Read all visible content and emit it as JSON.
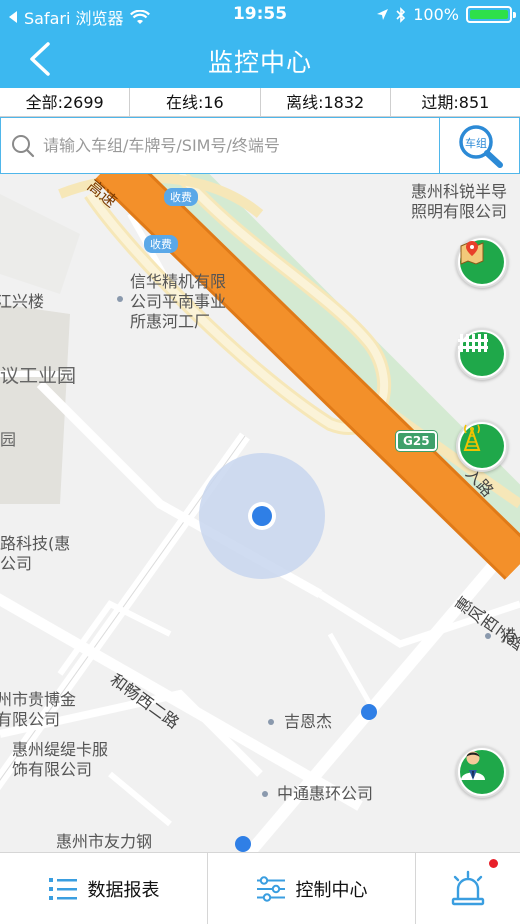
{
  "status_bar": {
    "carrier": "Safari 浏览器",
    "time": "19:55",
    "battery": "100%"
  },
  "nav": {
    "title": "监控中心"
  },
  "stats": [
    {
      "label": "全部:2699"
    },
    {
      "label": "在线:16"
    },
    {
      "label": "离线:1832"
    },
    {
      "label": "过期:851"
    }
  ],
  "search": {
    "placeholder": "请输入车组/车牌号/SIM号/终端号",
    "group_label": "车组"
  },
  "map": {
    "labels": {
      "kerui": "惠州科锐半导\n照明有限公司",
      "xinhua": "信华精机有限\n公司平南事业\n所惠河工厂",
      "xinglou": "江兴楼",
      "yiyuan": "议工业园",
      "yuan": "园",
      "luke": "路科技(惠\n公司",
      "guibo": "州市贵博金\n有限公司",
      "titika": "惠州缇缇卡服\n饰有限公司",
      "jienjie": "吉恩杰",
      "zhongtong": "中通惠环公司",
      "youli": "惠州市友力钢",
      "lie": "猎",
      "heyang": "和畅西二路",
      "huifeng": "惠风西二路",
      "gaosu": "高速",
      "xu": "入路"
    },
    "toll_1": "收费",
    "toll_2": "收费",
    "highway": "G25"
  },
  "tabs": [
    {
      "label": "数据报表"
    },
    {
      "label": "控制中心"
    }
  ],
  "colors": {
    "primary": "#3cb8f0",
    "highway": "#f3902a",
    "float_green": "#1fa84a",
    "alert": "#e8202a"
  }
}
